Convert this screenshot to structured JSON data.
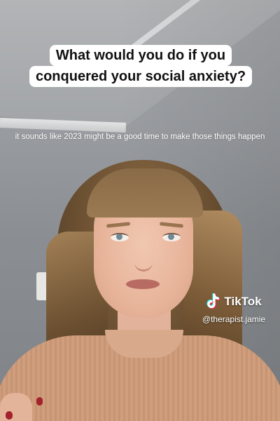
{
  "overlay": {
    "question_line1": "What would you do if you",
    "question_line2": "conquered your social anxiety?",
    "caption": "it sounds like 2023 might be a good time to make those things happen"
  },
  "watermark": {
    "brand": "TikTok",
    "handle": "@therapist.jamie",
    "icon": "tiktok-logo-icon"
  },
  "colors": {
    "text_box": "#ffffff",
    "text": "#111111",
    "nail_polish": "#a3222b",
    "sweater": "#cf9e7d"
  }
}
